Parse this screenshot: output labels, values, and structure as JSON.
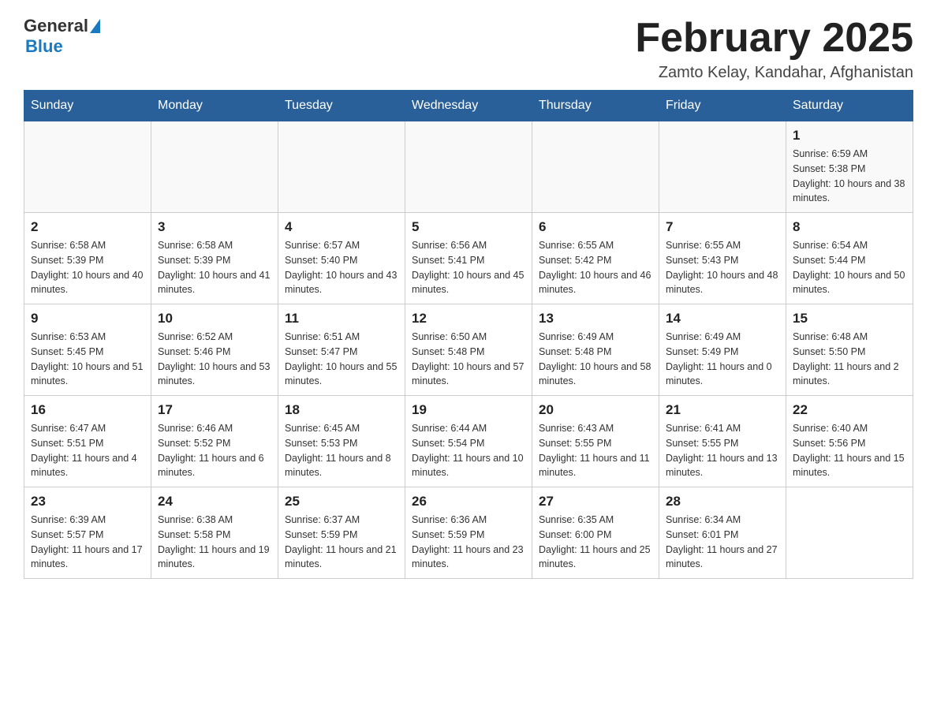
{
  "header": {
    "logo_general": "General",
    "logo_blue": "Blue",
    "month_title": "February 2025",
    "location": "Zamto Kelay, Kandahar, Afghanistan"
  },
  "days_of_week": [
    "Sunday",
    "Monday",
    "Tuesday",
    "Wednesday",
    "Thursday",
    "Friday",
    "Saturday"
  ],
  "weeks": [
    {
      "days": [
        {
          "num": "",
          "info": ""
        },
        {
          "num": "",
          "info": ""
        },
        {
          "num": "",
          "info": ""
        },
        {
          "num": "",
          "info": ""
        },
        {
          "num": "",
          "info": ""
        },
        {
          "num": "",
          "info": ""
        },
        {
          "num": "1",
          "info": "Sunrise: 6:59 AM\nSunset: 5:38 PM\nDaylight: 10 hours and 38 minutes."
        }
      ]
    },
    {
      "days": [
        {
          "num": "2",
          "info": "Sunrise: 6:58 AM\nSunset: 5:39 PM\nDaylight: 10 hours and 40 minutes."
        },
        {
          "num": "3",
          "info": "Sunrise: 6:58 AM\nSunset: 5:39 PM\nDaylight: 10 hours and 41 minutes."
        },
        {
          "num": "4",
          "info": "Sunrise: 6:57 AM\nSunset: 5:40 PM\nDaylight: 10 hours and 43 minutes."
        },
        {
          "num": "5",
          "info": "Sunrise: 6:56 AM\nSunset: 5:41 PM\nDaylight: 10 hours and 45 minutes."
        },
        {
          "num": "6",
          "info": "Sunrise: 6:55 AM\nSunset: 5:42 PM\nDaylight: 10 hours and 46 minutes."
        },
        {
          "num": "7",
          "info": "Sunrise: 6:55 AM\nSunset: 5:43 PM\nDaylight: 10 hours and 48 minutes."
        },
        {
          "num": "8",
          "info": "Sunrise: 6:54 AM\nSunset: 5:44 PM\nDaylight: 10 hours and 50 minutes."
        }
      ]
    },
    {
      "days": [
        {
          "num": "9",
          "info": "Sunrise: 6:53 AM\nSunset: 5:45 PM\nDaylight: 10 hours and 51 minutes."
        },
        {
          "num": "10",
          "info": "Sunrise: 6:52 AM\nSunset: 5:46 PM\nDaylight: 10 hours and 53 minutes."
        },
        {
          "num": "11",
          "info": "Sunrise: 6:51 AM\nSunset: 5:47 PM\nDaylight: 10 hours and 55 minutes."
        },
        {
          "num": "12",
          "info": "Sunrise: 6:50 AM\nSunset: 5:48 PM\nDaylight: 10 hours and 57 minutes."
        },
        {
          "num": "13",
          "info": "Sunrise: 6:49 AM\nSunset: 5:48 PM\nDaylight: 10 hours and 58 minutes."
        },
        {
          "num": "14",
          "info": "Sunrise: 6:49 AM\nSunset: 5:49 PM\nDaylight: 11 hours and 0 minutes."
        },
        {
          "num": "15",
          "info": "Sunrise: 6:48 AM\nSunset: 5:50 PM\nDaylight: 11 hours and 2 minutes."
        }
      ]
    },
    {
      "days": [
        {
          "num": "16",
          "info": "Sunrise: 6:47 AM\nSunset: 5:51 PM\nDaylight: 11 hours and 4 minutes."
        },
        {
          "num": "17",
          "info": "Sunrise: 6:46 AM\nSunset: 5:52 PM\nDaylight: 11 hours and 6 minutes."
        },
        {
          "num": "18",
          "info": "Sunrise: 6:45 AM\nSunset: 5:53 PM\nDaylight: 11 hours and 8 minutes."
        },
        {
          "num": "19",
          "info": "Sunrise: 6:44 AM\nSunset: 5:54 PM\nDaylight: 11 hours and 10 minutes."
        },
        {
          "num": "20",
          "info": "Sunrise: 6:43 AM\nSunset: 5:55 PM\nDaylight: 11 hours and 11 minutes."
        },
        {
          "num": "21",
          "info": "Sunrise: 6:41 AM\nSunset: 5:55 PM\nDaylight: 11 hours and 13 minutes."
        },
        {
          "num": "22",
          "info": "Sunrise: 6:40 AM\nSunset: 5:56 PM\nDaylight: 11 hours and 15 minutes."
        }
      ]
    },
    {
      "days": [
        {
          "num": "23",
          "info": "Sunrise: 6:39 AM\nSunset: 5:57 PM\nDaylight: 11 hours and 17 minutes."
        },
        {
          "num": "24",
          "info": "Sunrise: 6:38 AM\nSunset: 5:58 PM\nDaylight: 11 hours and 19 minutes."
        },
        {
          "num": "25",
          "info": "Sunrise: 6:37 AM\nSunset: 5:59 PM\nDaylight: 11 hours and 21 minutes."
        },
        {
          "num": "26",
          "info": "Sunrise: 6:36 AM\nSunset: 5:59 PM\nDaylight: 11 hours and 23 minutes."
        },
        {
          "num": "27",
          "info": "Sunrise: 6:35 AM\nSunset: 6:00 PM\nDaylight: 11 hours and 25 minutes."
        },
        {
          "num": "28",
          "info": "Sunrise: 6:34 AM\nSunset: 6:01 PM\nDaylight: 11 hours and 27 minutes."
        },
        {
          "num": "",
          "info": ""
        }
      ]
    }
  ]
}
